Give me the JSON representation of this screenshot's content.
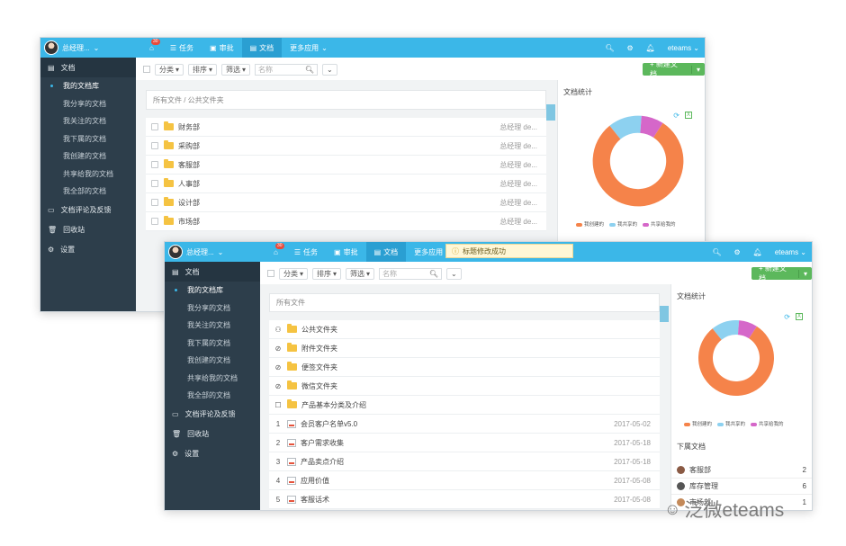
{
  "colors": {
    "topbar": "#3bb7e8",
    "sidebar": "#2d3e4b",
    "donut_orange": "#f5834a",
    "donut_blue": "#8dd1f0",
    "donut_pink": "#d567c9",
    "green": "#5cb85c"
  },
  "back": {
    "user": "总经理...",
    "nav": [
      {
        "label": "任务",
        "icon": "list-icon"
      },
      {
        "label": "审批",
        "icon": "approval-icon"
      },
      {
        "label": "文档",
        "icon": "doc-icon"
      },
      {
        "label": "更多应用",
        "icon": "chevron-down-icon"
      }
    ],
    "home_badge": "30",
    "brand": "eteams",
    "sidebar": {
      "doc_section": "文档",
      "items": [
        "我的文档库",
        "我分享的文档",
        "我关注的文档",
        "我下属的文档",
        "我创建的文档",
        "共享给我的文档",
        "我全部的文档"
      ],
      "sections": [
        "文档评论及反馈",
        "回收站",
        "设置"
      ]
    },
    "toolbar": {
      "classify": "分类",
      "sort": "排序",
      "filter": "筛选",
      "search_placeholder": "名称",
      "new_doc": "+ 新建文档"
    },
    "breadcrumb": "所有文件 / 公共文件夹",
    "rows": [
      {
        "name": "财务部",
        "meta": "总经理 de..."
      },
      {
        "name": "采购部",
        "meta": "总经理 de..."
      },
      {
        "name": "客服部",
        "meta": "总经理 de..."
      },
      {
        "name": "人事部",
        "meta": "总经理 de..."
      },
      {
        "name": "设计部",
        "meta": "总经理 de..."
      },
      {
        "name": "市场部",
        "meta": "总经理 de..."
      }
    ],
    "stats_title": "文档统计"
  },
  "front": {
    "user": "总经理...",
    "nav": [
      {
        "label": "任务",
        "icon": "list-icon"
      },
      {
        "label": "审批",
        "icon": "approval-icon"
      },
      {
        "label": "文档",
        "icon": "doc-icon"
      },
      {
        "label": "更多应用",
        "icon": "chevron-down-icon"
      }
    ],
    "home_badge": "30",
    "brand": "eteams",
    "toast": "标题修改成功",
    "sidebar": {
      "doc_section": "文档",
      "items": [
        "我的文档库",
        "我分享的文档",
        "我关注的文档",
        "我下属的文档",
        "我创建的文档",
        "共享给我的文档",
        "我全部的文档"
      ],
      "sections": [
        "文档评论及反馈",
        "回收站",
        "设置"
      ]
    },
    "toolbar": {
      "classify": "分类",
      "sort": "排序",
      "filter": "筛选",
      "search_placeholder": "名称",
      "new_doc": "+ 新建文档"
    },
    "breadcrumb": "所有文件",
    "folders": [
      "公共文件夹",
      "附件文件夹",
      "便签文件夹",
      "微信文件夹",
      "产品基本分类及介绍"
    ],
    "docs": [
      {
        "num": "1",
        "name": "会员客户名单v5.0",
        "date": "2017-05-02"
      },
      {
        "num": "2",
        "name": "客户需求收集",
        "date": "2017-05-18"
      },
      {
        "num": "3",
        "name": "产品卖点介绍",
        "date": "2017-05-18"
      },
      {
        "num": "4",
        "name": "应用价值",
        "date": "2017-05-08"
      },
      {
        "num": "5",
        "name": "客服话术",
        "date": "2017-05-08"
      }
    ],
    "stats_title": "文档统计",
    "legend": [
      "我创建的",
      "我共享的",
      "共享给我的"
    ],
    "sub_title": "下属文档",
    "sub_docs": [
      {
        "name": "客服部",
        "count": "2"
      },
      {
        "name": "库存管理",
        "count": "6"
      },
      {
        "name": "市场部",
        "count": "1"
      }
    ]
  },
  "chart_data": {
    "type": "pie",
    "title": "文档统计",
    "categories": [
      "我创建的",
      "我共享的",
      "共享给我的"
    ],
    "values": [
      80,
      12,
      8
    ],
    "donut": true
  },
  "watermark": "泛微eteams"
}
